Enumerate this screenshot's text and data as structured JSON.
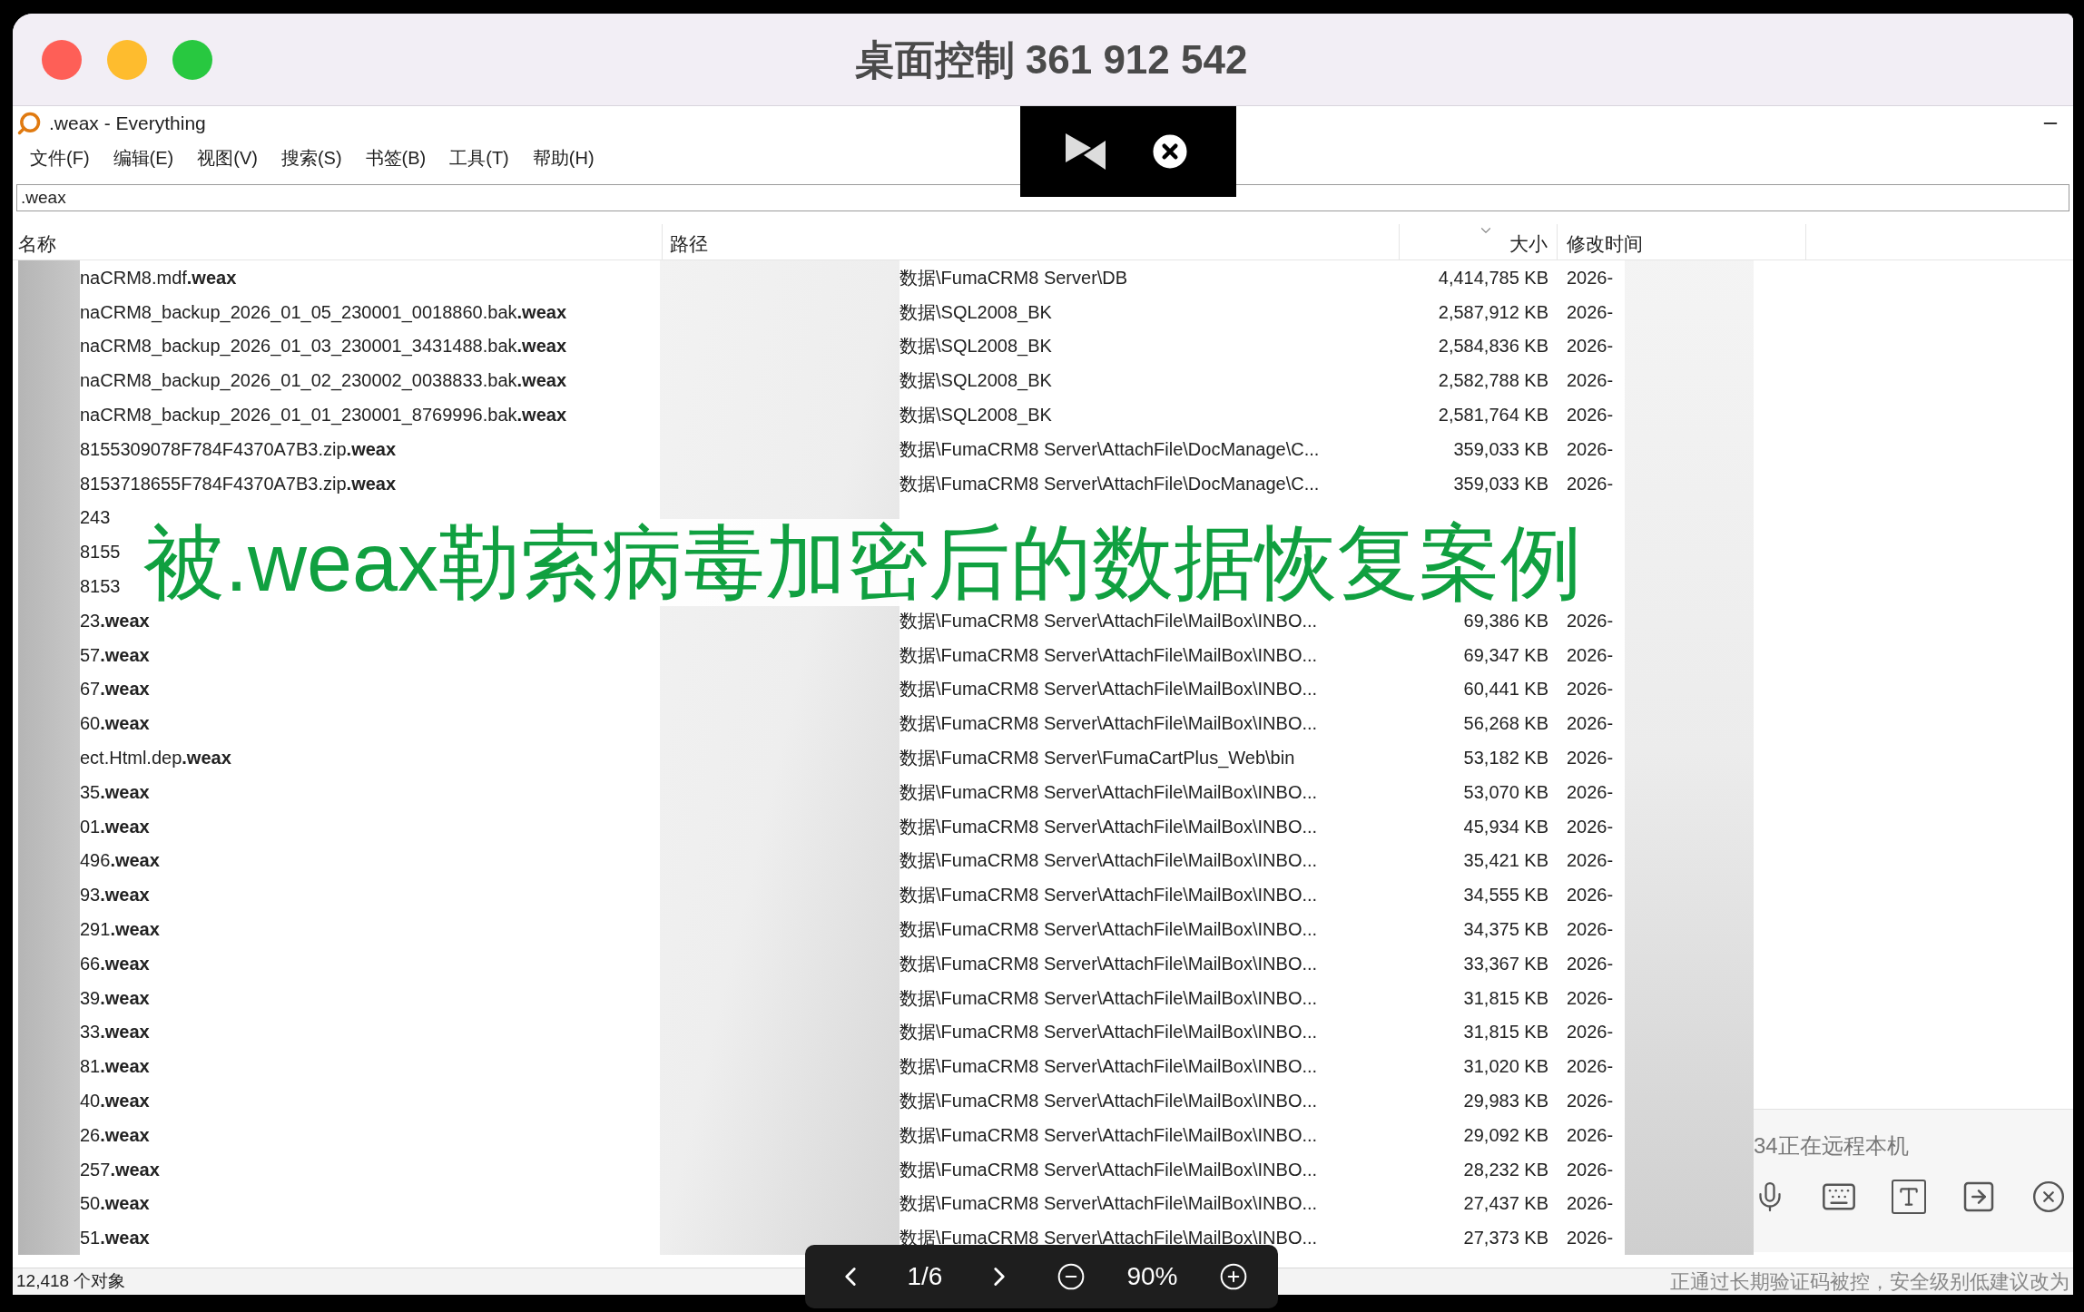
{
  "remote_window": {
    "title": "桌面控制 361 912 542"
  },
  "app": {
    "title": ".weax - Everything",
    "menu": [
      "文件(F)",
      "编辑(E)",
      "视图(V)",
      "搜索(S)",
      "书签(B)",
      "工具(T)",
      "帮助(H)"
    ],
    "search": {
      "value": ".weax"
    },
    "columns": [
      "名称",
      "路径",
      "大小",
      "修改时间"
    ],
    "rows": [
      {
        "name": "naCRM8.mdf**.weax**",
        "path": "数据\\FumaCRM8 Server\\DB",
        "size": "4,414,785 KB",
        "modified": "2026-"
      },
      {
        "name": "naCRM8_backup_2026_01_05_230001_0018860.bak**.weax**",
        "path": "数据\\SQL2008_BK",
        "size": "2,587,912 KB",
        "modified": "2026-"
      },
      {
        "name": "naCRM8_backup_2026_01_03_230001_3431488.bak**.weax**",
        "path": "数据\\SQL2008_BK",
        "size": "2,584,836 KB",
        "modified": "2026-"
      },
      {
        "name": "naCRM8_backup_2026_01_02_230002_0038833.bak**.weax**",
        "path": "数据\\SQL2008_BK",
        "size": "2,582,788 KB",
        "modified": "2026-"
      },
      {
        "name": "naCRM8_backup_2026_01_01_230001_8769996.bak**.weax**",
        "path": "数据\\SQL2008_BK",
        "size": "2,581,764 KB",
        "modified": "2026-"
      },
      {
        "name": "8155309078F784F4370A7B3.zip**.weax**",
        "path": "数据\\FumaCRM8 Server\\AttachFile\\DocManage\\C...",
        "size": "359,033 KB",
        "modified": "2026-"
      },
      {
        "name": "8153718655F784F4370A7B3.zip**.weax**",
        "path": "数据\\FumaCRM8 Server\\AttachFile\\DocManage\\C...",
        "size": "359,033 KB",
        "modified": "2026-"
      },
      {
        "name": "243"
      },
      {
        "name": "8155"
      },
      {
        "name": "8153"
      },
      {
        "name": "23**.weax**",
        "path": "数据\\FumaCRM8 Server\\AttachFile\\MailBox\\INBO...",
        "size": "69,386 KB",
        "modified": "2026-"
      },
      {
        "name": "57**.weax**",
        "path": "数据\\FumaCRM8 Server\\AttachFile\\MailBox\\INBO...",
        "size": "69,347 KB",
        "modified": "2026-"
      },
      {
        "name": "67**.weax**",
        "path": "数据\\FumaCRM8 Server\\AttachFile\\MailBox\\INBO...",
        "size": "60,441 KB",
        "modified": "2026-"
      },
      {
        "name": "60**.weax**",
        "path": "数据\\FumaCRM8 Server\\AttachFile\\MailBox\\INBO...",
        "size": "56,268 KB",
        "modified": "2026-"
      },
      {
        "name": "ect.Html.dep**.weax**",
        "path": "数据\\FumaCRM8 Server\\FumaCartPlus_Web\\bin",
        "size": "53,182 KB",
        "modified": "2026-"
      },
      {
        "name": "35**.weax**",
        "path": "数据\\FumaCRM8 Server\\AttachFile\\MailBox\\INBO...",
        "size": "53,070 KB",
        "modified": "2026-"
      },
      {
        "name": "01**.weax**",
        "path": "数据\\FumaCRM8 Server\\AttachFile\\MailBox\\INBO...",
        "size": "45,934 KB",
        "modified": "2026-"
      },
      {
        "name": "496**.weax**",
        "path": "数据\\FumaCRM8 Server\\AttachFile\\MailBox\\INBO...",
        "size": "35,421 KB",
        "modified": "2026-"
      },
      {
        "name": "93**.weax**",
        "path": "数据\\FumaCRM8 Server\\AttachFile\\MailBox\\INBO...",
        "size": "34,555 KB",
        "modified": "2026-"
      },
      {
        "name": "291**.weax**",
        "path": "数据\\FumaCRM8 Server\\AttachFile\\MailBox\\INBO...",
        "size": "34,375 KB",
        "modified": "2026-"
      },
      {
        "name": "66**.weax**",
        "path": "数据\\FumaCRM8 Server\\AttachFile\\MailBox\\INBO...",
        "size": "33,367 KB",
        "modified": "2026-"
      },
      {
        "name": "39**.weax**",
        "path": "数据\\FumaCRM8 Server\\AttachFile\\MailBox\\INBO...",
        "size": "31,815 KB",
        "modified": "2026-"
      },
      {
        "name": "33**.weax**",
        "path": "数据\\FumaCRM8 Server\\AttachFile\\MailBox\\INBO...",
        "size": "31,815 KB",
        "modified": "2026-"
      },
      {
        "name": "81**.weax**",
        "path": "数据\\FumaCRM8 Server\\AttachFile\\MailBox\\INBO...",
        "size": "31,020 KB",
        "modified": "2026-"
      },
      {
        "name": "40**.weax**",
        "path": "数据\\FumaCRM8 Server\\AttachFile\\MailBox\\INBO...",
        "size": "29,983 KB",
        "modified": "2026-"
      },
      {
        "name": "26**.weax**",
        "path": "数据\\FumaCRM8 Server\\AttachFile\\MailBox\\INBO...",
        "size": "29,092 KB",
        "modified": "2026-"
      },
      {
        "name": "257**.weax**",
        "path": "数据\\FumaCRM8 Server\\AttachFile\\MailBox\\INBO...",
        "size": "28,232 KB",
        "modified": "2026-"
      },
      {
        "name": "50**.weax**",
        "path": "数据\\FumaCRM8 Server\\AttachFile\\MailBox\\INBO...",
        "size": "27,437 KB",
        "modified": "2026-"
      },
      {
        "name": "51**.weax**",
        "path": "数据\\FumaCRM8 Server\\AttachFile\\MailBox\\INBO...",
        "size": "27,373 KB",
        "modified": "2026-"
      }
    ],
    "status": "12,418 个对象"
  },
  "viewer_bar": {
    "page": "1/6",
    "zoom": "90%"
  },
  "session_panel": {
    "message": "34正在远程本机",
    "notice": "正通过长期验证码被控，安全级别低建议改为"
  },
  "caption": "被.weax勒索病毒加密后的数据恢复案例"
}
